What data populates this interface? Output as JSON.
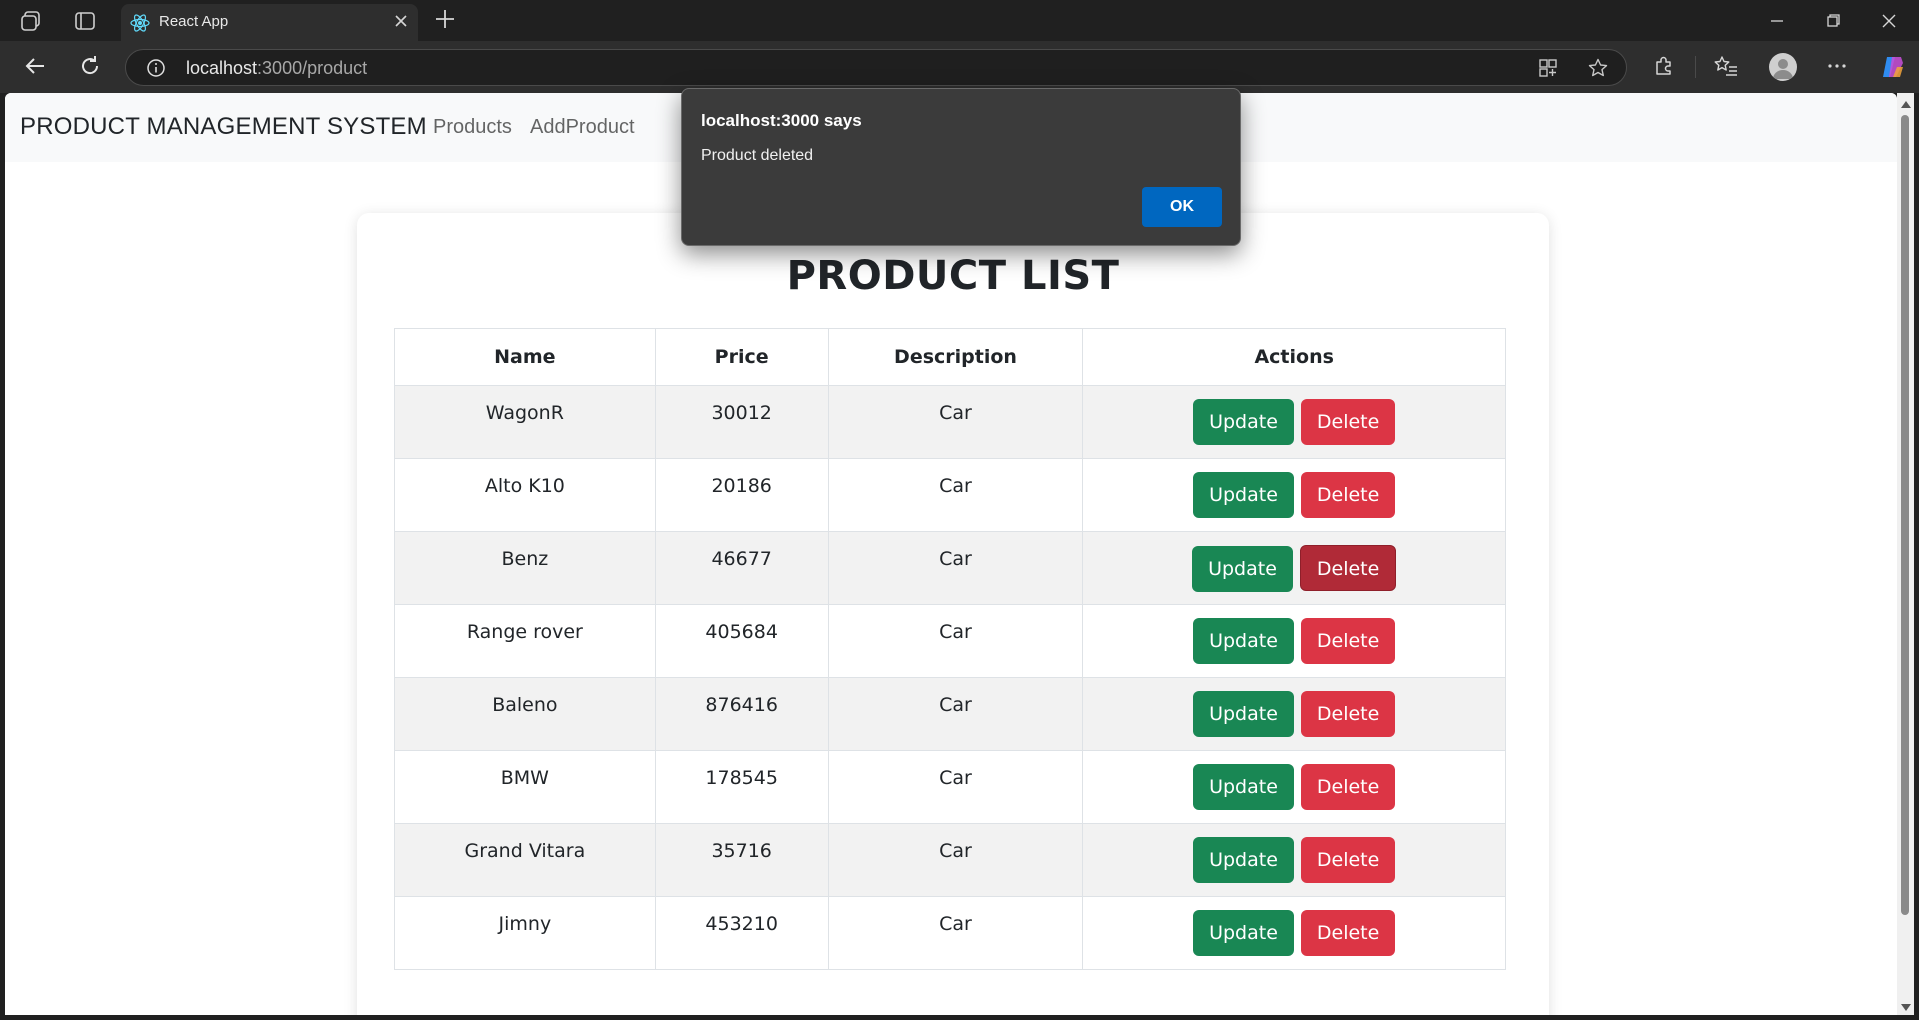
{
  "browser": {
    "tab_title": "React App",
    "url_host": "localhost",
    "url_path": ":3000/product"
  },
  "app": {
    "brand": "PRODUCT MANAGEMENT SYSTEM",
    "nav": [
      "Products",
      "AddProduct"
    ]
  },
  "dialog": {
    "title": "localhost:3000 says",
    "message": "Product deleted",
    "ok_label": "OK"
  },
  "product_list": {
    "title": "PRODUCT LIST",
    "columns": [
      "Name",
      "Price",
      "Description",
      "Actions"
    ],
    "update_label": "Update",
    "delete_label": "Delete",
    "rows": [
      {
        "name": "WagonR",
        "price": "30012",
        "description": "Car"
      },
      {
        "name": "Alto K10",
        "price": "20186",
        "description": "Car"
      },
      {
        "name": "Benz",
        "price": "46677",
        "description": "Car"
      },
      {
        "name": "Range rover",
        "price": "405684",
        "description": "Car"
      },
      {
        "name": "Baleno",
        "price": "876416",
        "description": "Car"
      },
      {
        "name": "BMW",
        "price": "178545",
        "description": "Car"
      },
      {
        "name": "Grand Vitara",
        "price": "35716",
        "description": "Car"
      },
      {
        "name": "Jimny",
        "price": "453210",
        "description": "Car"
      }
    ]
  },
  "colors": {
    "update_button": "#198754",
    "delete_button": "#dc3545",
    "delete_button_pressed": "#b02a37",
    "dialog_ok": "#0067c0"
  }
}
